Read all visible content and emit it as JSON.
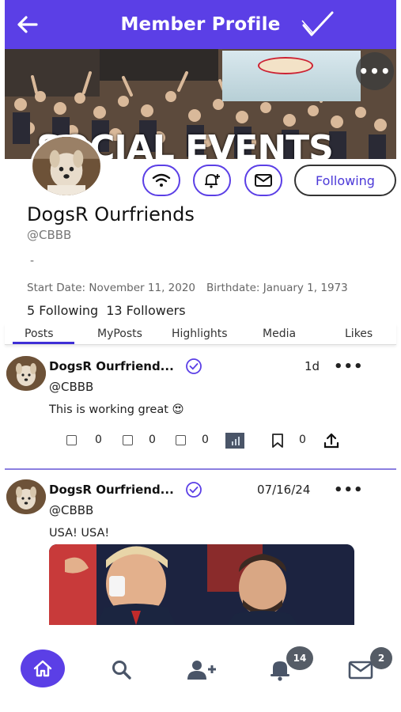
{
  "header": {
    "title": "Member Profile",
    "back_icon": "arrow-left-icon",
    "check_icon": "checkmark-icon",
    "background": "#5b3fe6"
  },
  "banner": {
    "text": "SOCIAL EVENTS",
    "more_label": "•••"
  },
  "profile": {
    "name": "DogsR Ourfriends",
    "handle": "@CBBB",
    "bio": "-",
    "start_date": "Start Date: November 11, 2020",
    "birthdate": "Birthdate: January 1, 1973",
    "following": "5 Following",
    "followers": "13 Followers",
    "follow_button": "Following"
  },
  "action_icons": [
    "wifi-icon",
    "bell-plus-icon",
    "mail-icon"
  ],
  "tabs": [
    {
      "label": "Posts",
      "active": true
    },
    {
      "label": "MyPosts",
      "active": false
    },
    {
      "label": "Highlights",
      "active": false
    },
    {
      "label": "Media",
      "active": false
    },
    {
      "label": "Likes",
      "active": false
    }
  ],
  "posts": [
    {
      "author": "DogsR Ourfriend...",
      "handle": "@CBBB",
      "time": "1d",
      "more": "•••",
      "text": "This is working great",
      "emoji": "😍",
      "counts": [
        "0",
        "0",
        "0",
        "0"
      ]
    },
    {
      "author": "DogsR Ourfriend...",
      "handle": "@CBBB",
      "time": "07/16/24",
      "more": "•••",
      "text": "USA! USA!"
    }
  ],
  "nav": {
    "items": [
      "home-icon",
      "search-icon",
      "add-user-icon",
      "bell-icon",
      "mail-icon"
    ],
    "notifications_badge": "14",
    "messages_badge": "2"
  },
  "colors": {
    "accent": "#5b3fe6",
    "divider": "#8b7fe0",
    "tab_underline": "#3f2fd6"
  }
}
